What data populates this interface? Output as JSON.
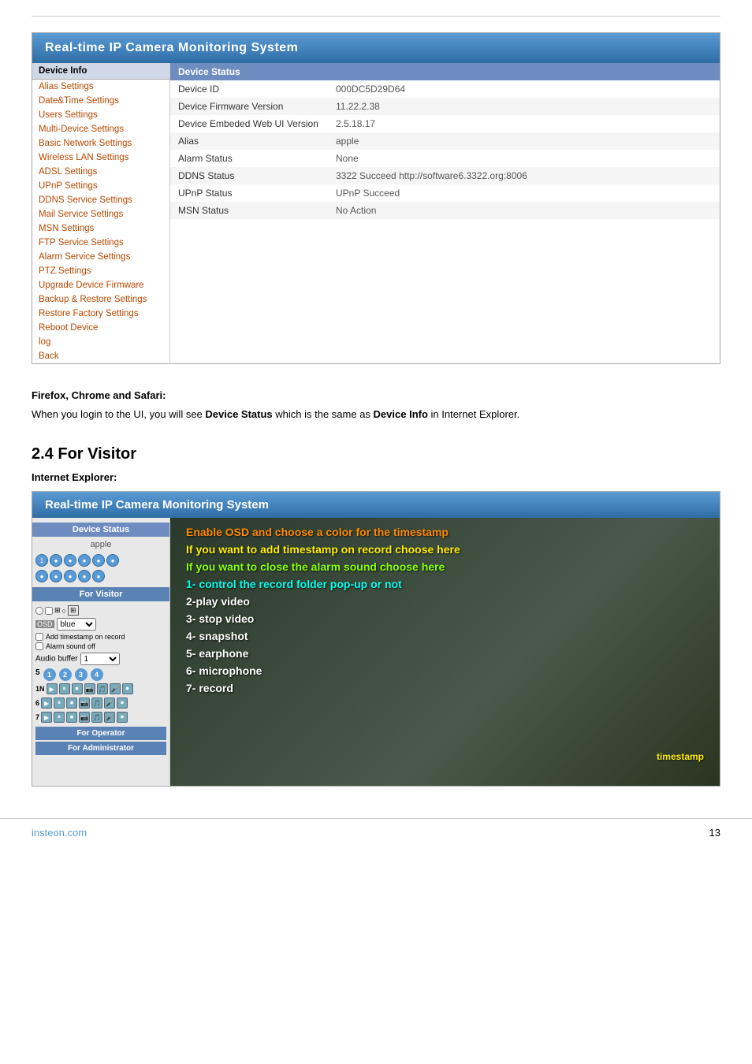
{
  "top_rule": true,
  "camera_panel_1": {
    "title": "Real-time IP Camera Monitoring System",
    "sidebar": {
      "items": [
        {
          "label": "Device Info",
          "type": "header"
        },
        {
          "label": "Alias Settings",
          "type": "link"
        },
        {
          "label": "Date&Time Settings",
          "type": "link"
        },
        {
          "label": "Users Settings",
          "type": "link"
        },
        {
          "label": "Multi-Device Settings",
          "type": "link"
        },
        {
          "label": "Basic Network Settings",
          "type": "link"
        },
        {
          "label": "Wireless LAN Settings",
          "type": "link"
        },
        {
          "label": "ADSL Settings",
          "type": "link"
        },
        {
          "label": "UPnP Settings",
          "type": "link"
        },
        {
          "label": "DDNS Service Settings",
          "type": "link"
        },
        {
          "label": "Mail Service Settings",
          "type": "link"
        },
        {
          "label": "MSN Settings",
          "type": "link"
        },
        {
          "label": "FTP Service Settings",
          "type": "link"
        },
        {
          "label": "Alarm Service Settings",
          "type": "link",
          "active": true
        },
        {
          "label": "PTZ Settings",
          "type": "link"
        },
        {
          "label": "Upgrade Device Firmware",
          "type": "link"
        },
        {
          "label": "Backup & Restore Settings",
          "type": "link"
        },
        {
          "label": "Restore Factory Settings",
          "type": "link"
        },
        {
          "label": "Reboot Device",
          "type": "link"
        },
        {
          "label": "log",
          "type": "link"
        },
        {
          "label": "Back",
          "type": "link"
        }
      ]
    },
    "device_status": {
      "header": "Device Status",
      "rows": [
        {
          "label": "Device ID",
          "value": "000DC5D29D64"
        },
        {
          "label": "Device Firmware Version",
          "value": "11.22.2.38"
        },
        {
          "label": "Device Embeded Web UI Version",
          "value": "2.5.18.17"
        },
        {
          "label": "Alias",
          "value": "apple"
        },
        {
          "label": "Alarm Status",
          "value": "None"
        },
        {
          "label": "DDNS Status",
          "value": "3322 Succeed  http://software6.3322.org:8006"
        },
        {
          "label": "UPnP Status",
          "value": "UPnP Succeed"
        },
        {
          "label": "MSN Status",
          "value": "No Action"
        }
      ]
    }
  },
  "browser_note": {
    "heading": "Firefox, Chrome and Safari:",
    "body_pre": "When you login to the UI, you will see ",
    "bold1": "Device Status",
    "body_mid": " which is the same as ",
    "bold2": "Device Info",
    "body_post": " in Internet Explorer."
  },
  "section_24": {
    "title": "2.4 For Visitor",
    "subtitle": "Internet Explorer:",
    "camera_panel": {
      "title": "Real-time IP Camera Monitoring System",
      "sidebar": {
        "device_status_label": "Device Status",
        "alias": "apple",
        "for_visitor_label": "For Visitor",
        "osd_label": "OSD",
        "osd_color": "blue",
        "add_timestamp_label": "Add timestamp on record",
        "alarm_sound_label": "Alarm sound off",
        "audio_buffer_label": "Audio buffer",
        "audio_buffer_value": "1",
        "nums": [
          "1",
          "2",
          "3",
          "4"
        ],
        "rows_count": 3,
        "for_operator_label": "For Operator",
        "for_admin_label": "For Administrator"
      },
      "overlay": {
        "line1": "Enable OSD and choose a color for the timestamp",
        "line2": "If you want to add timestamp on record choose here",
        "line3": "If you want to close the alarm sound choose here",
        "line4": "1- control the record folder pop-up or not",
        "line5": "2-play video",
        "line6": "3- stop video",
        "line7": "4- snapshot",
        "line8": "5- earphone",
        "line9": "6- microphone",
        "line10": "7- record",
        "timestamp_label": "timestamp"
      }
    }
  },
  "footer": {
    "brand": "insteon.com",
    "page_number": "13"
  }
}
